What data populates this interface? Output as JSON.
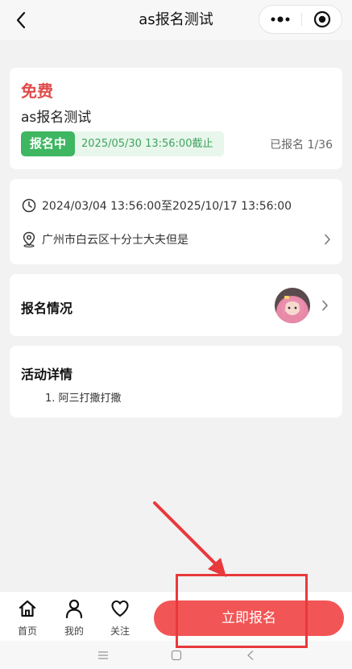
{
  "navbar": {
    "title": "as报名测试",
    "back_icon": "chevron-left-icon",
    "more_icon": "more-dots-icon",
    "close_icon": "target-close-icon"
  },
  "event": {
    "price": "免费",
    "name": "as报名测试",
    "status": "报名中",
    "deadline": "2025/05/30 13:56:00截止",
    "signup_count": "已报名 1/36"
  },
  "info": {
    "time": "2024/03/04 13:56:00至2025/10/17 13:56:00",
    "location": "广州市白云区十分士大夫但是"
  },
  "registration": {
    "heading": "报名情况"
  },
  "details": {
    "heading": "活动详情",
    "items": [
      "1. 阿三打撒打撒"
    ]
  },
  "bottom_bar": {
    "tabs": [
      {
        "label": "首页",
        "icon": "home-icon"
      },
      {
        "label": "我的",
        "icon": "user-icon"
      },
      {
        "label": "关注",
        "icon": "heart-icon"
      }
    ],
    "signup_label": "立即报名"
  },
  "colors": {
    "accent_red": "#f25555",
    "price_red": "#e04b4b",
    "status_green": "#3fb661",
    "annotation_red": "#e8393c"
  }
}
